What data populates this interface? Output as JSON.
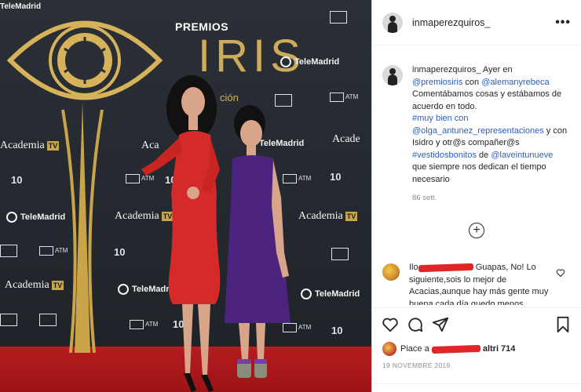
{
  "backdrop": {
    "premios": "PREMIOS",
    "iris": "IRIS",
    "edicion": "ción",
    "academia": "Academia",
    "academia_tv": "TV",
    "telemadrid": "TeleMadrid",
    "atm": "ATM",
    "fundacion_number": "10",
    "corner_text": "TeleMadrid",
    "acade_partial": "Acade",
    "aca_partial": "Aca",
    "academia_partial_right": "Academ"
  },
  "post": {
    "author": "inmaperezquiros_",
    "more_label": "•••",
    "caption": {
      "user": "inmaperezquiros_",
      "text_1": "Ayer en",
      "mention_1": "@premiosiris",
      "text_2": "con",
      "mention_2": "@alemanyrebeca",
      "text_3": "Comentábamos cosas y estábamos de acuerdo en todo.",
      "hashtag_1": "#muy bien con",
      "mention_3": "@olga_antunez_representaciones",
      "text_4": "y con Isidro y otr@s compañer@s",
      "hashtag_2": "#vestidosbonitos",
      "text_5": "de",
      "mention_4": "@laveintunueve",
      "text_6": "que siempre nos dedican el tiempo necesario",
      "time_ago": "86 sett."
    },
    "load_more_symbol": "+",
    "comment": {
      "text_1": "Guapas, No! Lo siguiente,sois lo mejor de Acacias,aunque hay más gente muy buena cada día quedo menos",
      "prefix": "Ilo"
    },
    "likes": {
      "prefix": "Piace a",
      "suffix": "altri 714"
    },
    "date": "19 NOVEMBRE 2019"
  },
  "colors": {
    "link": "#2f5db8",
    "redaction": "#e02626",
    "gold": "#d6b25b",
    "carpet": "#b51c1e"
  },
  "icons": {
    "more": "more-icon",
    "heart": "heart-icon",
    "comment": "comment-icon",
    "share": "paper-plane-icon",
    "save": "bookmark-icon",
    "add": "plus-circle-icon"
  }
}
